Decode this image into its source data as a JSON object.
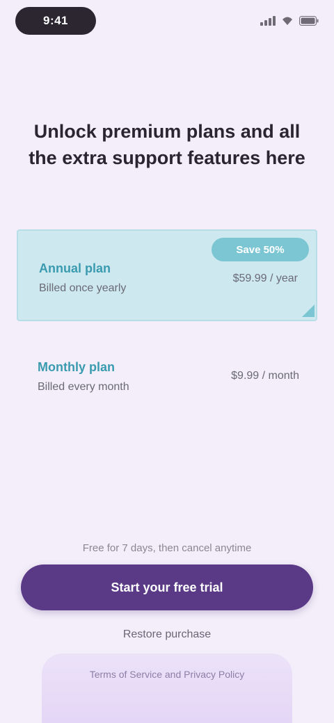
{
  "status_bar": {
    "time": "9:41"
  },
  "heading": "Unlock premium plans and all the extra support features here",
  "plans": {
    "annual": {
      "name": "Annual plan",
      "subtitle": "Billed once yearly",
      "price": "$59.99 / year",
      "badge": "Save 50%"
    },
    "monthly": {
      "name": "Monthly plan",
      "subtitle": "Billed every month",
      "price": "$9.99 / month"
    }
  },
  "trial_note": "Free for 7 days, then cancel anytime",
  "cta_label": "Start your free trial",
  "restore_label": "Restore purchase",
  "terms_text": "Terms of Service and Privacy Policy",
  "colors": {
    "accent": "#5a3a86",
    "teal": "#3a9bb0",
    "background": "#f3eef9"
  }
}
